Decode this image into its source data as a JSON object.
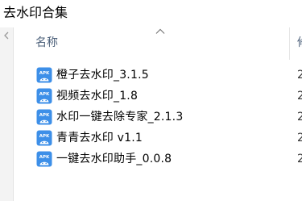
{
  "window": {
    "title": "去水印合集"
  },
  "columns": {
    "name_label": "名称",
    "second_label": "修"
  },
  "files": [
    {
      "name": "橙子去水印_3.1.5",
      "date_partial": "2",
      "icon": "apk-icon"
    },
    {
      "name": "视频去水印_1.8",
      "date_partial": "2",
      "icon": "apk-icon"
    },
    {
      "name": "水印一键去除专家_2.1.3",
      "date_partial": "2",
      "icon": "apk-icon"
    },
    {
      "name": "青青去水印 v1.1",
      "date_partial": "2",
      "icon": "apk-icon"
    },
    {
      "name": "一键去水印助手_0.0.8",
      "date_partial": "2",
      "icon": "apk-icon"
    }
  ],
  "icons": {
    "apk_badge_text": "APK",
    "apk_color": "#3d8fe8"
  }
}
